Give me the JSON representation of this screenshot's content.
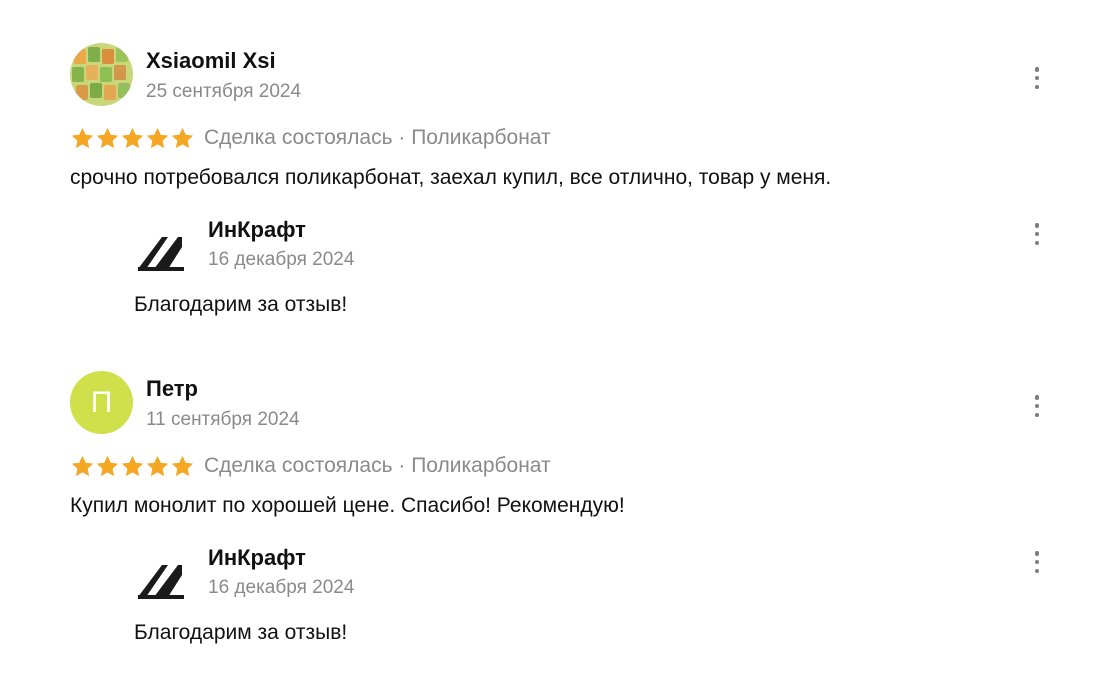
{
  "reviews": [
    {
      "author": "Xsiaomil Xsi",
      "date": "25 сентября 2024",
      "avatar_letter": "",
      "rating": 5,
      "meta": "Сделка состоялась · Поликарбонат",
      "text": "срочно потребовался поликарбонат, заехал купил, все отлично, товар у меня.",
      "reply": {
        "author": "ИнКрафт",
        "date": "16 декабря 2024",
        "text": "Благодарим за отзыв!"
      }
    },
    {
      "author": "Петр",
      "date": "11 сентября 2024",
      "avatar_letter": "П",
      "rating": 5,
      "meta": "Сделка состоялась · Поликарбонат",
      "text": "Купил монолит по хорошей цене. Спасибо! Рекомендую!",
      "reply": {
        "author": "ИнКрафт",
        "date": "16 декабря 2024",
        "text": "Благодарим за отзыв!"
      }
    }
  ],
  "icons": {
    "star": "star-icon",
    "more": "more-vertical-icon",
    "company_logo": "inkraft-logo"
  },
  "colors": {
    "star": "#f5a623",
    "avatar_petr": "#cfe04a",
    "secondary_text": "#8a8a8a"
  }
}
